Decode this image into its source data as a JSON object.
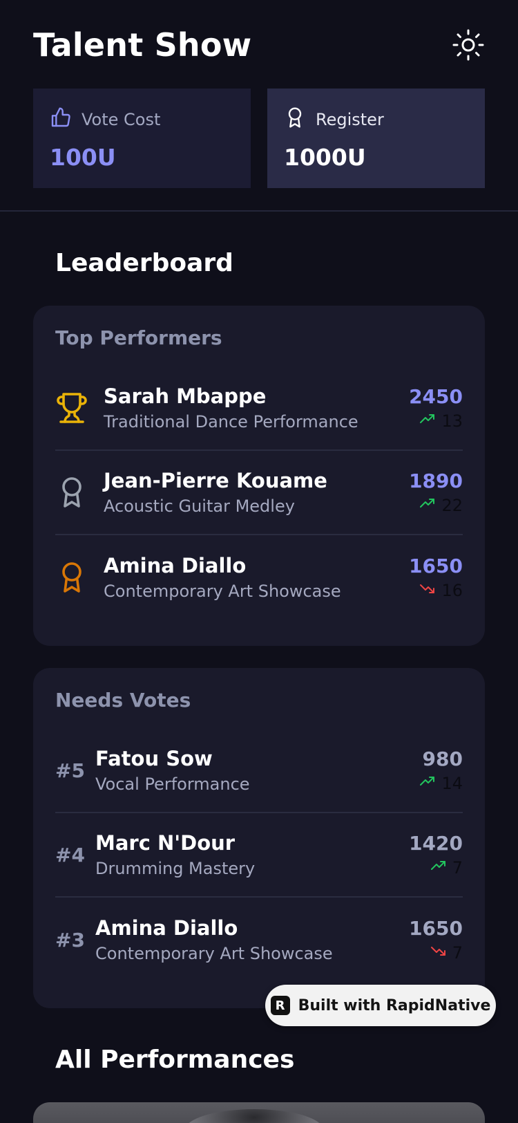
{
  "header": {
    "title": "Talent Show",
    "theme_icon": "sun-icon"
  },
  "stats": {
    "vote": {
      "label": "Vote Cost",
      "value": "100U",
      "icon": "thumbs-up-icon"
    },
    "register": {
      "label": "Register",
      "value": "1000U",
      "icon": "award-icon"
    }
  },
  "leaderboard": {
    "title": "Leaderboard",
    "top": {
      "title": "Top Performers",
      "items": [
        {
          "name": "Sarah Mbappe",
          "desc": "Traditional Dance Performance",
          "score": "2450",
          "change": "13",
          "trend": "up",
          "icon": "trophy-icon"
        },
        {
          "name": "Jean-Pierre Kouame",
          "desc": "Acoustic Guitar Medley",
          "score": "1890",
          "change": "22",
          "trend": "up",
          "icon": "silver-medal-icon"
        },
        {
          "name": "Amina Diallo",
          "desc": "Contemporary Art Showcase",
          "score": "1650",
          "change": "16",
          "trend": "down",
          "icon": "bronze-medal-icon"
        }
      ]
    },
    "needs": {
      "title": "Needs Votes",
      "items": [
        {
          "rank": "#5",
          "name": "Fatou Sow",
          "desc": "Vocal Performance",
          "score": "980",
          "change": "14",
          "trend": "up"
        },
        {
          "rank": "#4",
          "name": "Marc N'Dour",
          "desc": "Drumming Mastery",
          "score": "1420",
          "change": "7",
          "trend": "up"
        },
        {
          "rank": "#3",
          "name": "Amina Diallo",
          "desc": "Contemporary Art Showcase",
          "score": "1650",
          "change": "7",
          "trend": "down"
        }
      ]
    }
  },
  "performances": {
    "title": "All Performances"
  },
  "badge": {
    "text": "Built with RapidNative"
  },
  "colors": {
    "accent": "#8b8ff5",
    "up": "#22c55e",
    "down": "#ef4444",
    "gold": "#eab308",
    "silver": "#9ca3af",
    "bronze": "#d97706"
  }
}
